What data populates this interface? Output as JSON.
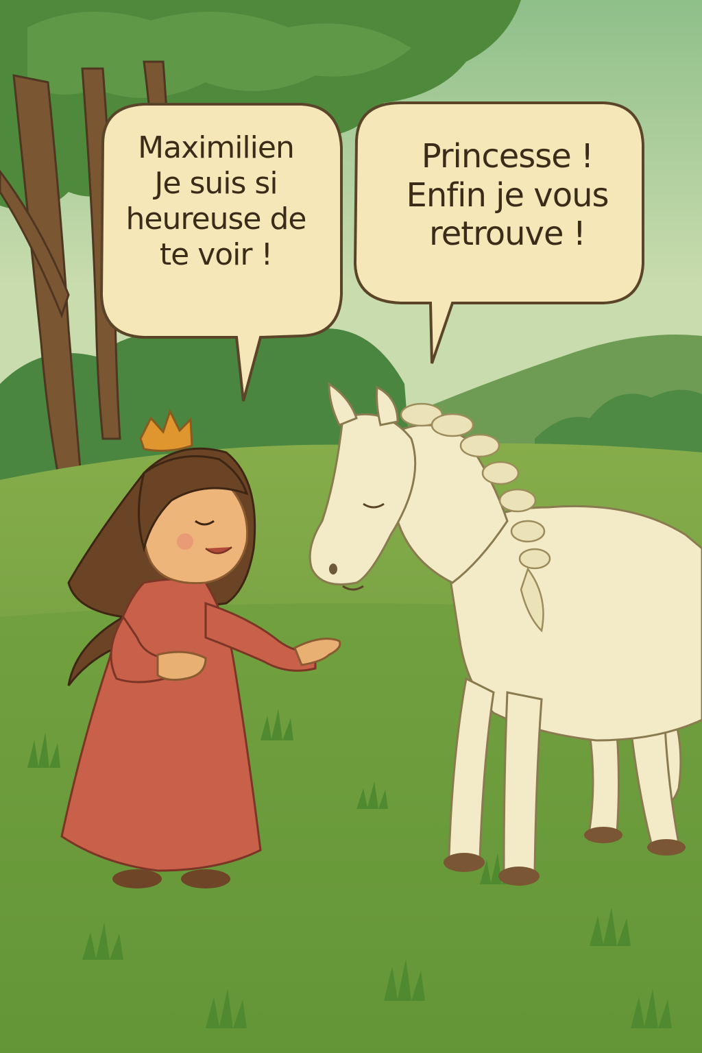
{
  "speech_bubbles": {
    "princess": {
      "lines": [
        "Maximilien",
        "Je suis si",
        "heureuse de",
        "te voir !"
      ]
    },
    "horse": {
      "lines": [
        "Princesse !",
        "Enfin je vous",
        "retrouve !"
      ]
    }
  },
  "palette": {
    "sky_top": "#9fc28a",
    "sky_bottom": "#cfe0b0",
    "meadow": "#6f9a3c",
    "dress": "#c8604a",
    "crown": "#e0962e",
    "horse_body": "#f3ebc8",
    "bubble_fill": "#f6e7b8",
    "outline": "#5a4528"
  }
}
